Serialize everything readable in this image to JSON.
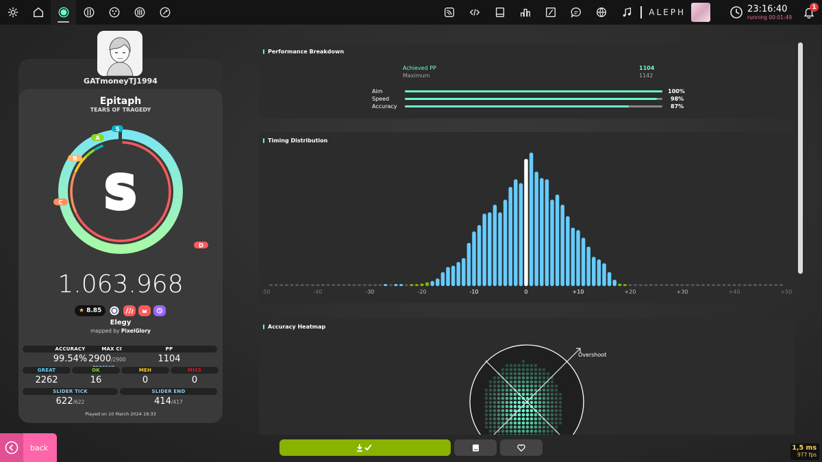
{
  "toolbar": {
    "left_icons": [
      "settings-icon",
      "home-icon",
      "ruleset-osu-icon",
      "ruleset-taiko-icon",
      "ruleset-catch-icon",
      "ruleset-mania-icon",
      "ruleset-custom-icon"
    ],
    "right_icons": [
      "news-icon",
      "code-icon",
      "beatmap-listing-icon",
      "rankings-icon",
      "changelog-icon",
      "chat-icon",
      "dashboard-icon",
      "music-icon"
    ],
    "username": "ALEPH",
    "clock_time": "23:16:40",
    "clock_running": "running 00:01:49",
    "notification_count": "1"
  },
  "player": {
    "name": "GATmoneyTJ1994"
  },
  "beatmap": {
    "title": "Epitaph",
    "artist": "TEARS OF TRAGEDY",
    "difficulty": "Elegy",
    "mapped_by_label": "mapped by",
    "mapper": "PixelGlory",
    "star_rating": "8.85"
  },
  "score": {
    "rank": "S",
    "total": "1.063.968",
    "accuracy_percent": 99.54,
    "rank_labels": [
      "S",
      "A",
      "B",
      "C",
      "D"
    ],
    "played_on": "Played on 10 March 2024 18:33"
  },
  "stats": {
    "accuracy": {
      "label": "ACCURACY",
      "value": "99.54%"
    },
    "max_combo": {
      "label": "MAX COMBO",
      "value": "2900",
      "max": "/2900",
      "badge": "PERFECT"
    },
    "pp": {
      "label": "PP",
      "value": "1104"
    },
    "great": {
      "label": "GREAT",
      "value": "2262"
    },
    "ok": {
      "label": "OK",
      "value": "16"
    },
    "meh": {
      "label": "MEH",
      "value": "0"
    },
    "miss": {
      "label": "MISS",
      "value": "0"
    },
    "slider_tick": {
      "label": "SLIDER TICK",
      "value": "622",
      "max": "/622"
    },
    "slider_end": {
      "label": "SLIDER END",
      "value": "414",
      "max": "/417"
    }
  },
  "performance": {
    "title": "Performance Breakdown",
    "achieved_label": "Achieved PP",
    "achieved_value": "1104",
    "maximum_label": "Maximum",
    "maximum_value": "1142",
    "bars": [
      {
        "label": "Aim",
        "percent": 100,
        "text": "100%"
      },
      {
        "label": "Speed",
        "percent": 98,
        "text": "98%"
      },
      {
        "label": "Accuracy",
        "percent": 87,
        "text": "87%"
      }
    ]
  },
  "timing": {
    "title": "Timing Distribution",
    "ticks": [
      "-50",
      "-40",
      "-30",
      "-20",
      "-10",
      "0",
      "+10",
      "+20",
      "+30",
      "+40",
      "+50"
    ]
  },
  "heatmap": {
    "title": "Accuracy Heatmap",
    "overshoot_label": "Overshoot"
  },
  "bottom": {
    "back_label": "back",
    "frame_time": "1,5 ms",
    "fps": "977 fps"
  },
  "colors": {
    "accent": "#66ffcc",
    "great_bar": "#66ccff",
    "ok_bar": "#88b300",
    "back": "#ff66aa",
    "download": "#88b300"
  },
  "chart_data": {
    "type": "bar",
    "title": "Timing Distribution",
    "xlabel": "",
    "ylabel": "",
    "xlim": [
      -50,
      50
    ],
    "x": [
      -49,
      -48,
      -47,
      -46,
      -45,
      -44,
      -43,
      -42,
      -41,
      -40,
      -39,
      -38,
      -37,
      -36,
      -35,
      -34,
      -33,
      -32,
      -31,
      -30,
      -29,
      -28,
      -27,
      -26,
      -25,
      -24,
      -23,
      -22,
      -21,
      -20,
      -19,
      -18,
      -17,
      -16,
      -15,
      -14,
      -13,
      -12,
      -11,
      -10,
      -9,
      -8,
      -7,
      -6,
      -5,
      -4,
      -3,
      -2,
      -1,
      0,
      1,
      2,
      3,
      4,
      5,
      6,
      7,
      8,
      9,
      10,
      11,
      12,
      13,
      14,
      15,
      16,
      17,
      18,
      19,
      20,
      21,
      22,
      23,
      24,
      25,
      26,
      27,
      28,
      29,
      30,
      31,
      32,
      33,
      34,
      35,
      36,
      37,
      38,
      39,
      40,
      41,
      42,
      43,
      44,
      45,
      46,
      47,
      48,
      49
    ],
    "values": [
      0,
      0,
      0,
      0,
      0,
      0,
      0,
      0,
      0,
      0,
      0,
      0,
      0,
      0,
      0,
      0,
      0,
      0,
      0,
      0,
      0,
      0,
      1,
      0,
      1,
      1,
      0,
      1,
      1,
      2,
      3,
      4,
      6,
      11,
      15,
      16,
      19,
      22,
      34,
      43,
      48,
      57,
      58,
      64,
      58,
      68,
      78,
      84,
      81,
      100,
      105,
      90,
      85,
      84,
      68,
      72,
      64,
      55,
      46,
      44,
      38,
      31,
      23,
      21,
      18,
      11,
      5,
      2,
      1,
      0,
      0,
      0,
      0,
      0,
      0,
      0,
      0,
      0,
      0,
      0,
      0,
      0,
      0,
      0,
      0,
      0,
      0,
      0,
      0,
      0,
      0,
      0,
      0,
      0,
      0,
      0,
      0,
      0,
      0
    ],
    "series_colors": {
      "great": "#66ccff",
      "ok": "#88b300",
      "zero": "#555555",
      "center": "#ffffff"
    }
  }
}
